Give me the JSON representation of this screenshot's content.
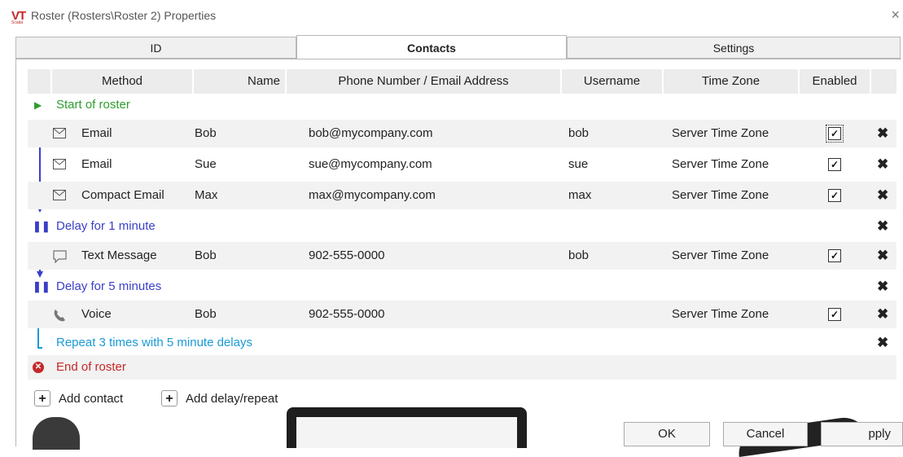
{
  "window": {
    "logo": "VT",
    "logo_sub": "Scada",
    "title": "Roster (Rosters\\Roster 2) Properties",
    "close_glyph": "×"
  },
  "tabs": [
    {
      "label": "ID",
      "active": false
    },
    {
      "label": "Contacts",
      "active": true
    },
    {
      "label": "Settings",
      "active": false
    }
  ],
  "columns": {
    "method": "Method",
    "name": "Name",
    "address": "Phone Number / Email Address",
    "username": "Username",
    "timezone": "Time Zone",
    "enabled": "Enabled"
  },
  "roster": {
    "start_label": "Start of roster",
    "end_label": "End of roster",
    "contacts": [
      {
        "icon": "envelope-icon",
        "method": "Email",
        "name": "Bob",
        "address": "bob@mycompany.com",
        "username": "bob",
        "timezone": "Server Time Zone",
        "enabled": "✓"
      },
      {
        "icon": "envelope-icon",
        "method": "Email",
        "name": "Sue",
        "address": "sue@mycompany.com",
        "username": "sue",
        "timezone": "Server Time Zone",
        "enabled": "✓"
      },
      {
        "icon": "envelope-icon",
        "method": "Compact Email",
        "name": "Max",
        "address": "max@mycompany.com",
        "username": "max",
        "timezone": "Server Time Zone",
        "enabled": "✓"
      },
      {
        "icon": "speech-bubble-icon",
        "method": "Text Message",
        "name": "Bob",
        "address": "902-555-0000",
        "username": "bob",
        "timezone": "Server Time Zone",
        "enabled": "✓"
      },
      {
        "icon": "phone-icon",
        "method": "Voice",
        "name": "Bob",
        "address": "902-555-0000",
        "username": "",
        "timezone": "Server Time Zone",
        "enabled": "✓"
      }
    ],
    "delays": [
      {
        "label": "Delay for 1 minute"
      },
      {
        "label": "Delay for 5 minutes"
      }
    ],
    "repeat_label": "Repeat 3 times with 5 minute delays",
    "delete_glyph": "✖"
  },
  "actions": {
    "add_contact": "Add contact",
    "add_delay": "Add delay/repeat",
    "plus": "+"
  },
  "buttons": {
    "ok": "OK",
    "cancel": "Cancel",
    "apply": "pply"
  },
  "colors": {
    "start_green": "#2e9e2e",
    "end_red": "#c62828",
    "delay_blue": "#3a3fc8",
    "repeat_cyan": "#1a9ad6",
    "flow_line": "#3a3fc8"
  }
}
